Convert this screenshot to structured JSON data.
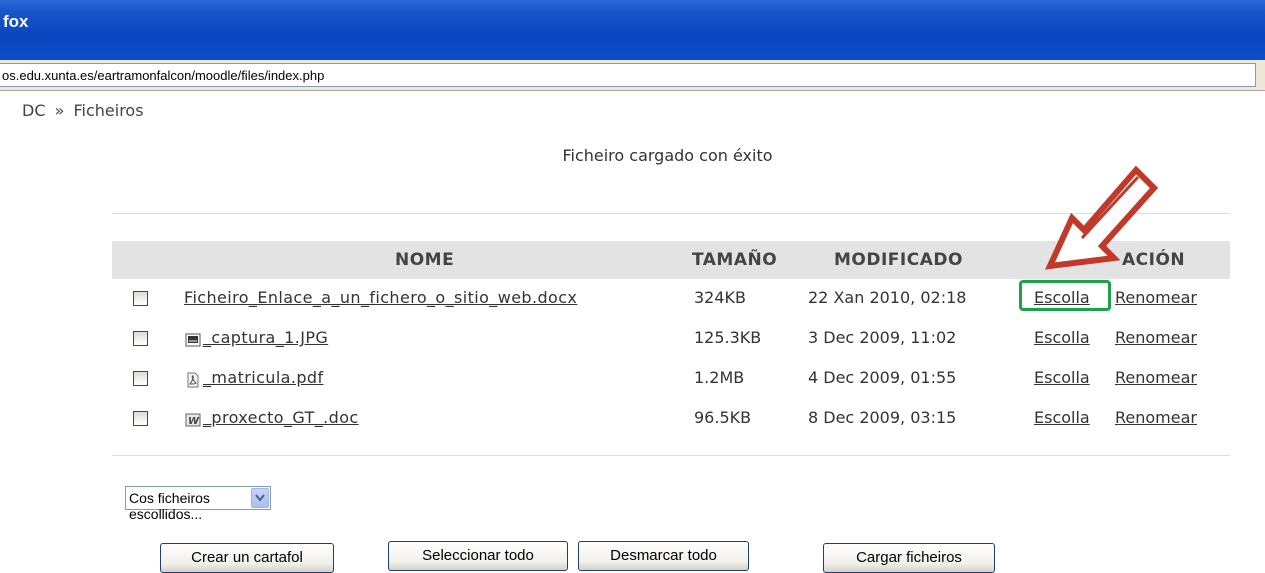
{
  "window": {
    "title": "fox"
  },
  "address_bar": {
    "url": "os.edu.xunta.es/eartramonfalcon/moodle/files/index.php"
  },
  "breadcrumb": {
    "items": [
      "DC",
      "»",
      "Ficheiros"
    ]
  },
  "notice": "Ficheiro cargado con éxito",
  "table": {
    "headers": {
      "name": "NOME",
      "size": "TAMAÑO",
      "modified": "MODIFICADO",
      "action": "ACIÓN"
    },
    "rows": [
      {
        "name": "Ficheiro_Enlace_a_un_fichero_o_sitio_web.docx",
        "icon": "none",
        "size": "324KB",
        "modified": "22 Xan 2010, 02:18",
        "choose": "Escolla",
        "rename": "Renomear"
      },
      {
        "name": "_captura_1.JPG",
        "icon": "image-file-icon",
        "size": "125.3KB",
        "modified": "3 Dec 2009, 11:02",
        "choose": "Escolla",
        "rename": "Renomear"
      },
      {
        "name": "_matricula.pdf",
        "icon": "pdf-file-icon",
        "size": "1.2MB",
        "modified": "4 Dec 2009, 01:55",
        "choose": "Escolla",
        "rename": "Renomear"
      },
      {
        "name": "_proxecto_GT_.doc",
        "icon": "word-file-icon",
        "size": "96.5KB",
        "modified": "8 Dec 2009, 03:15",
        "choose": "Escolla",
        "rename": "Renomear"
      }
    ]
  },
  "selected_action": {
    "value": "Cos ficheiros escollidos..."
  },
  "buttons": {
    "create_folder": "Crear un cartafol",
    "select_all": "Seleccionar todo",
    "deselect_all": "Desmarcar todo",
    "upload": "Cargar ficheiros"
  },
  "colors": {
    "highlight_box": "#1aa34a",
    "arrow": "#c0392b",
    "titlebar": "#0a46c0"
  }
}
